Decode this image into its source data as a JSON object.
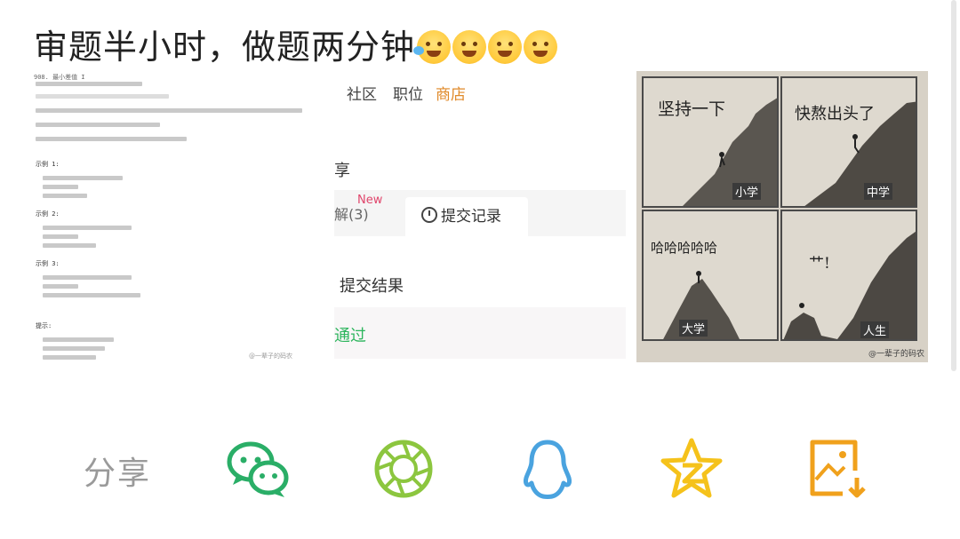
{
  "post": {
    "title": "审题半小时，做题两分钟",
    "emojis": [
      "rofl-face-icon",
      "hugging-face-icon",
      "hugging-face-icon",
      "hugging-face-icon"
    ]
  },
  "image1": {
    "doc_header": "908. 最小差值 I",
    "sample_titles": [
      "示例 1:",
      "示例 2:",
      "示例 3:",
      "提示:"
    ],
    "watermark": "@一辈子的码农",
    "nav": [
      "社区",
      "职位",
      "商店"
    ],
    "share": "享",
    "tab_comments": "解(3)",
    "tab_new": "New",
    "tab_submissions": "提交记录",
    "result_label": "提交结果",
    "result_value": "通过"
  },
  "image2": {
    "panels": [
      {
        "caption": "坚持一下",
        "stage": "小学"
      },
      {
        "caption": "快熬出头了",
        "stage": "中学"
      },
      {
        "caption": "哈哈哈哈哈",
        "stage": "大学"
      },
      {
        "caption": "艹!",
        "stage": "人生"
      }
    ],
    "watermark": "@一辈子的码农"
  },
  "share": {
    "label": "分享",
    "buttons": [
      {
        "name": "wechat",
        "color": "#2aae67"
      },
      {
        "name": "moments",
        "color": "#8cc63f"
      },
      {
        "name": "qq",
        "color": "#4aa3df"
      },
      {
        "name": "qzone",
        "color": "#f5c21b"
      },
      {
        "name": "save-image",
        "color": "#f0a11c"
      }
    ]
  }
}
